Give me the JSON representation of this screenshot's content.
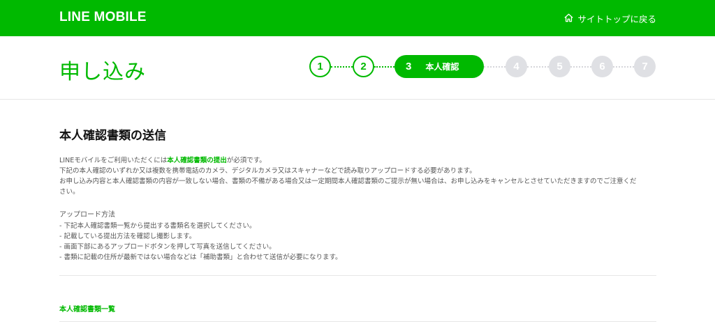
{
  "header": {
    "logo": "LINE MOBILE",
    "back_link": "サイトトップに戻る",
    "back_icon": "home-icon"
  },
  "page": {
    "title": "申し込み"
  },
  "steps": {
    "items": [
      "1",
      "2",
      "3",
      "4",
      "5",
      "6",
      "7"
    ],
    "current_index": 2,
    "current_label": "本人確認"
  },
  "main": {
    "section_title": "本人確認書類の送信",
    "intro": {
      "line1_pre": "LINEモバイルをご利用いただくには",
      "line1_highlight": "本人確認書類の提出",
      "line1_post": "が必須です。",
      "line2": "下記の本人確認のいずれか又は複数を携帯電話のカメラ、デジタルカメラ又はスキャナーなどで読み取りアップロードする必要があります。",
      "line3": "お申し込み内容と本人確認書類の内容が一致しない場合、書類の不備がある場合又は一定期間本人確認書類のご提示が無い場合は、お申し込みをキャンセルとさせていただきますのでご注意くだ",
      "line4": "さい。"
    },
    "method": {
      "heading": "アップロード方法",
      "items": [
        "- 下記本人確認書類一覧から提出する書類名を選択してください。",
        "- 記載している提出方法を確認し撮影します。",
        "- 画面下部にあるアップロードボタンを押して写真を送信してください。",
        "- 書類に記載の住所が最新ではない場合などは「補助書類」と合わせて送信が必要になります。"
      ]
    },
    "doc_list_link": "本人確認書類一覧"
  },
  "colors": {
    "brand": "#00b900",
    "inactive_step": "#dfe0e4"
  }
}
